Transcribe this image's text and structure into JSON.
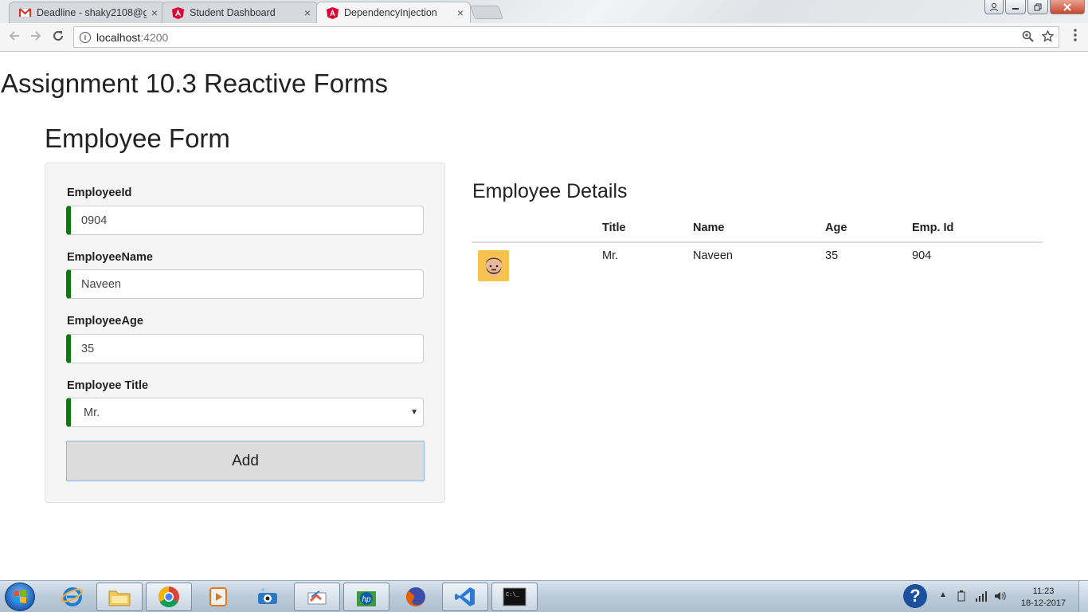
{
  "browser": {
    "tabs": [
      {
        "label": "Deadline - shaky2108@g",
        "close": "×"
      },
      {
        "label": "Student Dashboard",
        "close": "×"
      },
      {
        "label": "DependencyInjection",
        "close": "×",
        "active": true
      }
    ],
    "url_host": "localhost",
    "url_port": ":4200"
  },
  "page": {
    "title": "Assignment 10.3 Reactive Forms",
    "form": {
      "title": "Employee Form",
      "fields": [
        {
          "label": "EmployeeId",
          "value": "0904"
        },
        {
          "label": "EmployeeName",
          "value": "Naveen"
        },
        {
          "label": "EmployeeAge",
          "value": "35"
        },
        {
          "label": "Employee Title",
          "value": "Mr."
        }
      ],
      "add_label": "Add"
    },
    "details": {
      "title": "Employee Details",
      "columns": [
        "",
        "Title",
        "Name",
        "Age",
        "Emp. Id"
      ],
      "rows": [
        {
          "title": "Mr.",
          "name": "Naveen",
          "age": "35",
          "emp_id": "904"
        }
      ]
    }
  },
  "taskbar": {
    "time": "11:23",
    "date": "18-12-2017"
  },
  "colors": {
    "valid_border": "#0a7a0a",
    "avatar_bg": "#f7c24d"
  }
}
